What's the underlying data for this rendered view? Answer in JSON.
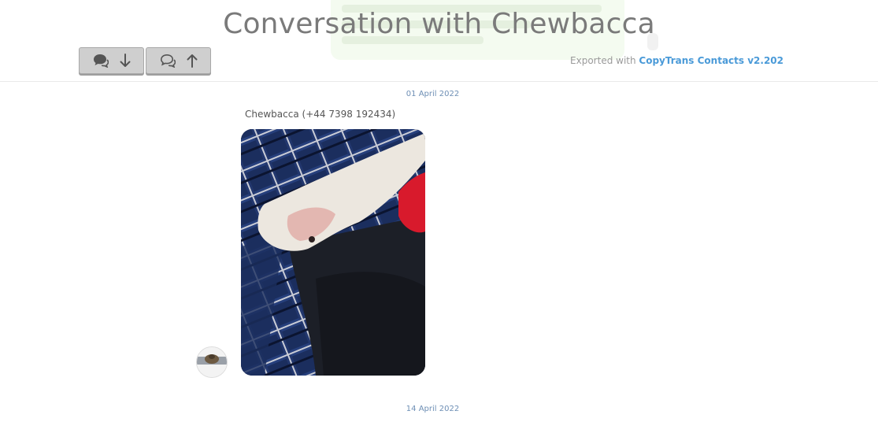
{
  "header": {
    "title": "Conversation with Chewbacca",
    "exported_prefix": "Exported with ",
    "exported_link": "CopyTrans Contacts v2.202"
  },
  "nav": {
    "down_icon": "chat-bubbles-icon",
    "down_arrow_icon": "arrow-down-icon",
    "up_icon": "chat-bubbles-outline-icon",
    "up_arrow_icon": "arrow-up-icon"
  },
  "messages": [
    {
      "date": "01 April 2022",
      "sender": "Chewbacca (+44 7398 192434)",
      "attachment": "photo"
    }
  ],
  "next_date": "14 April 2022",
  "colors": {
    "title": "#7a7a7a",
    "link": "#4a9ad8",
    "date": "#6e8fb5",
    "button": "#cfcfcf"
  }
}
